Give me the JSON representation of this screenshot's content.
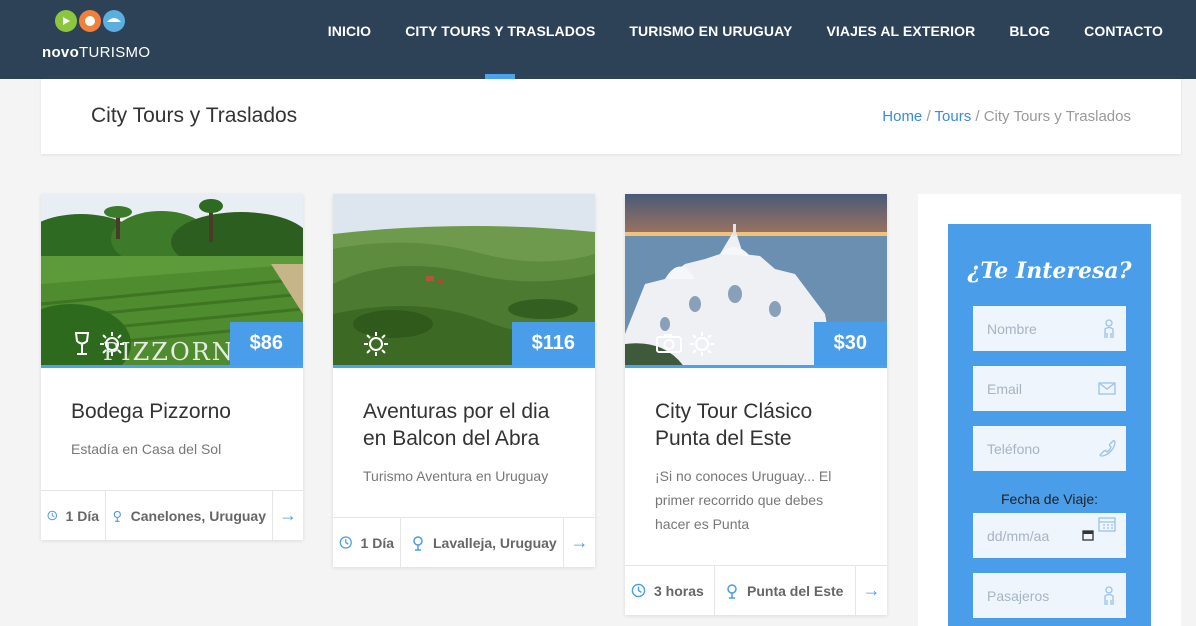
{
  "brand": {
    "name_bold": "novo",
    "name_rest": "TURISMO"
  },
  "nav": [
    {
      "label": "INICIO",
      "active": false
    },
    {
      "label": "CITY TOURS Y TRASLADOS",
      "active": true
    },
    {
      "label": "TURISMO EN URUGUAY",
      "active": false
    },
    {
      "label": "VIAJES AL EXTERIOR",
      "active": false
    },
    {
      "label": "BLOG",
      "active": false
    },
    {
      "label": "CONTACTO",
      "active": false
    }
  ],
  "page": {
    "title": "City Tours y Traslados",
    "breadcrumb": {
      "home": "Home",
      "sep": " / ",
      "tours": "Tours",
      "current": "City Tours y Traslados"
    }
  },
  "cards": [
    {
      "price": "$86",
      "title": "Bodega Pizzorno",
      "subtitle": "Estadía en Casa del Sol",
      "duration": "1 Día",
      "location": "Canelones, Uruguay",
      "watermark": "PIZZORNO"
    },
    {
      "price": "$116",
      "title": "Aventuras por el dia en Balcon del Abra",
      "subtitle": "Turismo Aventura en Uruguay",
      "duration": "1 Día",
      "location": "Lavalleja, Uruguay"
    },
    {
      "price": "$30",
      "title": "City Tour Clásico Punta del Este",
      "subtitle": "¡Si no conoces Uruguay... El primer recorrido que debes hacer es Punta",
      "duration": "3 horas",
      "location": "Punta del Este"
    }
  ],
  "form": {
    "title": "¿Te Interesa?",
    "name_placeholder": "Nombre",
    "email_placeholder": "Email",
    "phone_placeholder": "Teléfono",
    "date_label": "Fecha de Viaje:",
    "date_placeholder": "dd/mm/aa",
    "passengers_placeholder": "Pasajeros"
  },
  "colors": {
    "header": "#2e4257",
    "accent": "#4a9de8"
  },
  "icons": {
    "clock": "clock-icon",
    "location": "location-pin-icon",
    "arrow": "arrow-right-icon",
    "wine": "wine-glass-icon",
    "sun": "sun-icon",
    "camera": "camera-icon",
    "user": "user-icon",
    "mail": "envelope-icon",
    "phone": "phone-icon",
    "calendar": "calendar-icon"
  }
}
